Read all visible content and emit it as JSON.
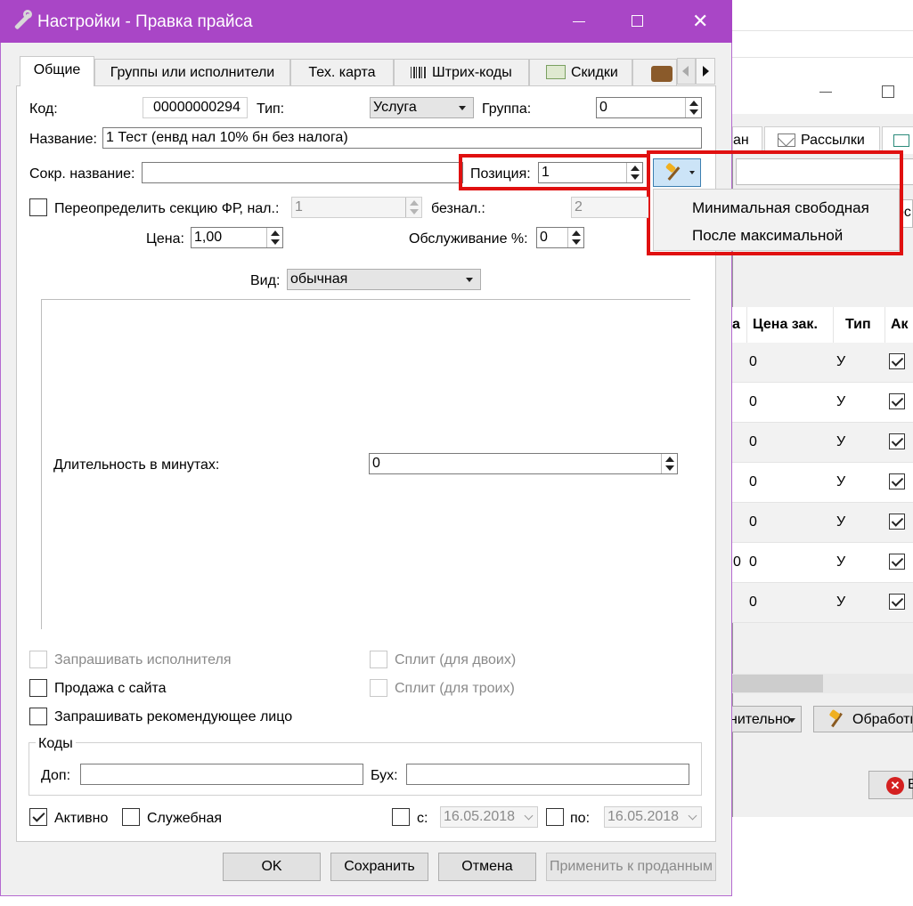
{
  "dialog": {
    "title": "Настройки - Правка прайса",
    "tabs": [
      "Общие",
      "Группы или исполнители",
      "Тех. карта",
      "Штрих-коды",
      "Скидки"
    ],
    "code_label": "Код:",
    "code_value": "00000000294",
    "type_label": "Тип:",
    "type_value": "Услуга",
    "group_label": "Группа:",
    "group_value": "0",
    "name_label": "Название:",
    "name_value": "1 Тест (енвд нал 10% бн без налога)",
    "short_name_label": "Сокр. название:",
    "short_name_value": "",
    "position_label": "Позиция:",
    "position_value": "1",
    "override_label": "Переопределить секцию ФР, нал.:",
    "override_cash_value": "1",
    "noncash_label": "безнал.:",
    "noncash_value": "2",
    "price_label": "Цена:",
    "price_value": "1,00",
    "service_label": "Обслуживание %:",
    "service_value": "0",
    "kind_label": "Вид:",
    "kind_value": "обычная",
    "duration_label": "Длительность в минутах:",
    "duration_value": "0",
    "checkboxes": {
      "ask_performer": "Запрашивать исполнителя",
      "site_sale": "Продажа с сайта",
      "ask_referrer": "Запрашивать рекомендующее лицо",
      "split_two": "Сплит (для двоих)",
      "split_three": "Сплит (для троих)"
    },
    "codes_group": "Коды",
    "extra_label": "Доп:",
    "extra_value": "",
    "acc_label": "Бух:",
    "acc_value": "",
    "active_label": "Активно",
    "active_checked": true,
    "service_flag_label": "Служебная",
    "from_label": "с:",
    "from_date": "16.05.2018",
    "to_label": "по:",
    "to_date": "16.05.2018",
    "buttons": {
      "ok": "OK",
      "save": "Сохранить",
      "cancel": "Отмена",
      "apply_sold": "Применить к проданным"
    }
  },
  "position_menu": {
    "items": [
      "Минимальная свободная",
      "После максимальной"
    ]
  },
  "background_window": {
    "tab_partial": "ан",
    "tab_mailings": "Рассылки",
    "field_partial": "ос",
    "headers": [
      "а",
      "Цена зак.",
      "Тип",
      "Ак"
    ],
    "rows": [
      {
        "left": "",
        "price": "0",
        "type": "У"
      },
      {
        "left": "",
        "price": "0",
        "type": "У"
      },
      {
        "left": "",
        "price": "0",
        "type": "У"
      },
      {
        "left": "",
        "price": "0",
        "type": "У"
      },
      {
        "left": "",
        "price": "0",
        "type": "У"
      },
      {
        "left": "0",
        "price": "0",
        "type": "У"
      },
      {
        "left": "",
        "price": "0",
        "type": "У"
      }
    ],
    "btn_additional": "нительно",
    "btn_processing": "Обработк",
    "btn_close_partial": "В"
  },
  "colors": {
    "titlebar": "#a946c6",
    "highlight": "#e01010",
    "window_bg": "#f0f0f0"
  }
}
